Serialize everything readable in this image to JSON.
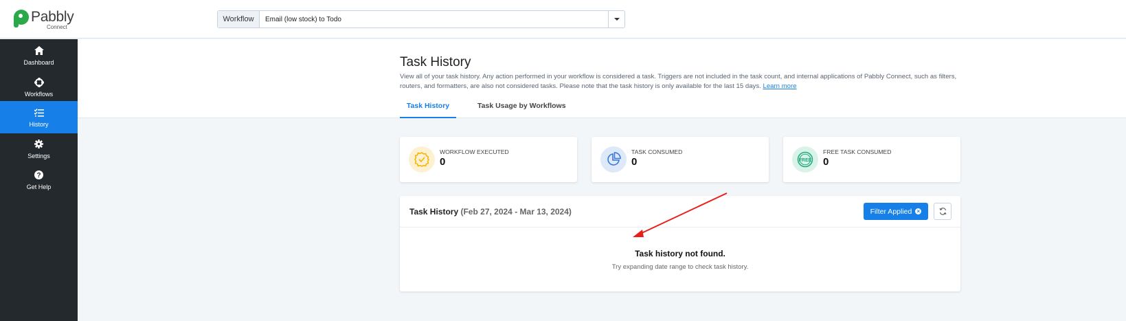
{
  "brand": {
    "name": "Pabbly",
    "sub": "Connect"
  },
  "workflow_selector": {
    "label": "Workflow",
    "value": "Email (low stock) to Todo"
  },
  "sidebar": {
    "items": [
      {
        "label": "Dashboard",
        "icon": "home-icon"
      },
      {
        "label": "Workflows",
        "icon": "workflows-icon"
      },
      {
        "label": "History",
        "icon": "history-list-icon",
        "active": true
      },
      {
        "label": "Settings",
        "icon": "gear-icon"
      },
      {
        "label": "Get Help",
        "icon": "help-icon"
      }
    ]
  },
  "page": {
    "title": "Task History",
    "description": "View all of your task history. Any action performed in your workflow is considered a task. Triggers are not included in the task count, and internal applications of Pabbly Connect, such as filters, routers, and formatters, are also not considered tasks. Please note that the task history is only available for the last 15 days.",
    "learn_more": "Learn more",
    "tabs": [
      {
        "label": "Task History",
        "active": true
      },
      {
        "label": "Task Usage by Workflows",
        "active": false
      }
    ]
  },
  "stats": [
    {
      "label": "WORKFLOW EXECUTED",
      "value": "0",
      "icon": "badge-check-icon",
      "color": "#f4b400",
      "bg": "#fdf1d2"
    },
    {
      "label": "TASK CONSUMED",
      "value": "0",
      "icon": "pie-chart-icon",
      "color": "#3a78d6",
      "bg": "#dde8f8"
    },
    {
      "label": "FREE TASK CONSUMED",
      "value": "0",
      "icon": "free-badge-icon",
      "color": "#1fa97b",
      "bg": "#d9f3e9"
    }
  ],
  "history_panel": {
    "title": "Task History",
    "range": "(Feb 27, 2024 - Mar 13, 2024)",
    "filter_button": "Filter Applied",
    "empty_title": "Task history not found.",
    "empty_subtitle": "Try expanding date range to check task history."
  },
  "colors": {
    "accent": "#1780e8",
    "sidebar": "#24292e",
    "annotation_arrow": "#e8201c"
  }
}
